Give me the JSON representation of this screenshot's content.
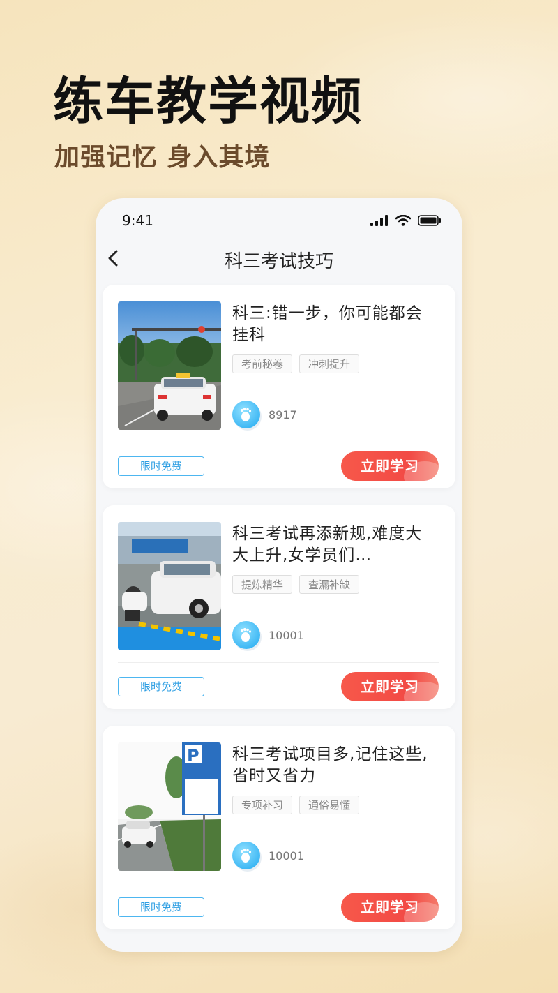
{
  "hero": {
    "title": "练车教学视频",
    "subtitle": "加强记忆 身入其境"
  },
  "status_bar": {
    "time": "9:41"
  },
  "nav": {
    "title": "科三考试技巧"
  },
  "cards": [
    {
      "title": "科三:错一步，你可能都会挂科",
      "tags": [
        "考前秘卷",
        "冲刺提升"
      ],
      "views": "8917",
      "badge": "限时免费",
      "button": "立即学习"
    },
    {
      "title": "科三考试再添新规,难度大大上升,女学员们…",
      "tags": [
        "提炼精华",
        "查漏补缺"
      ],
      "views": "10001",
      "badge": "限时免费",
      "button": "立即学习"
    },
    {
      "title": "科三考试项目多,记住这些,省时又省力",
      "tags": [
        "专项补习",
        "通俗易懂"
      ],
      "views": "10001",
      "badge": "限时免费",
      "button": "立即学习"
    }
  ],
  "colors": {
    "accent_red": "#f24a45",
    "accent_blue": "#2f9fe3",
    "background": "#f8ebd2"
  }
}
